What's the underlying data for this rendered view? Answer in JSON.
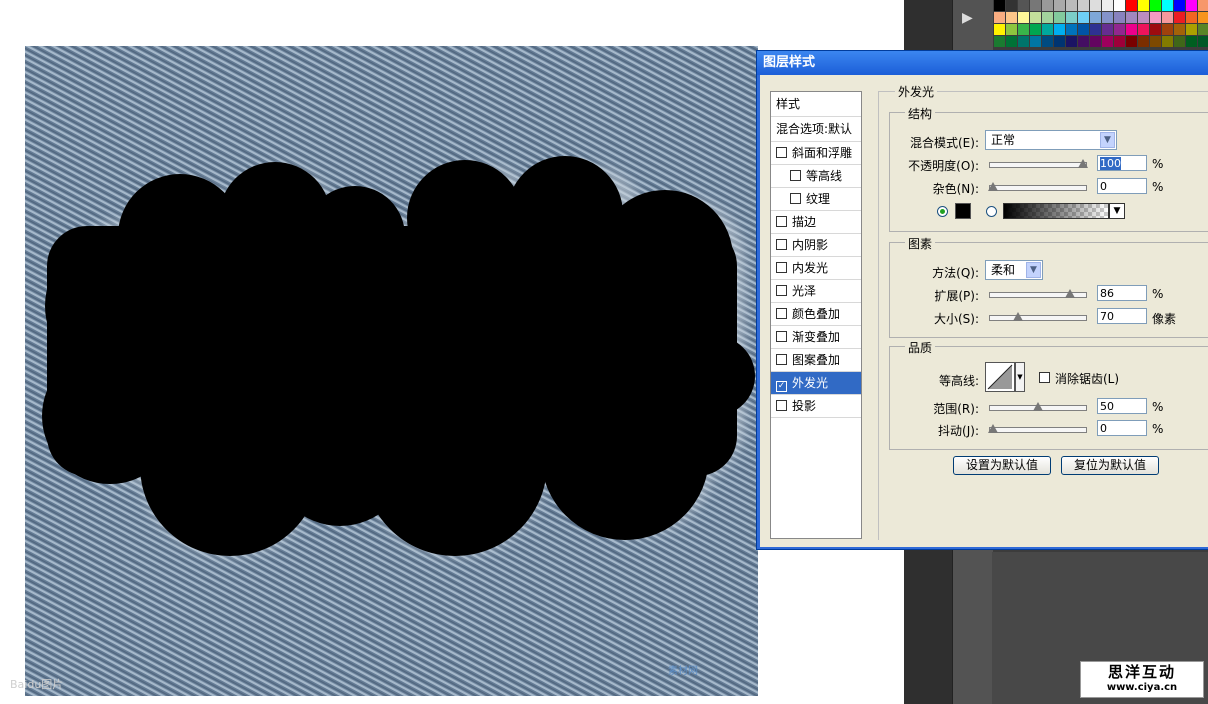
{
  "dialog": {
    "title": "图层样式",
    "style_list": {
      "header": "样式",
      "blend_default": "混合选项:默认",
      "items": [
        {
          "label": "斜面和浮雕",
          "checked": false,
          "indent": false
        },
        {
          "label": "等高线",
          "checked": false,
          "indent": true
        },
        {
          "label": "纹理",
          "checked": false,
          "indent": true
        },
        {
          "label": "描边",
          "checked": false,
          "indent": false
        },
        {
          "label": "内阴影",
          "checked": false,
          "indent": false
        },
        {
          "label": "内发光",
          "checked": false,
          "indent": false
        },
        {
          "label": "光泽",
          "checked": false,
          "indent": false
        },
        {
          "label": "颜色叠加",
          "checked": false,
          "indent": false
        },
        {
          "label": "渐变叠加",
          "checked": false,
          "indent": false
        },
        {
          "label": "图案叠加",
          "checked": false,
          "indent": false
        },
        {
          "label": "外发光",
          "checked": true,
          "indent": false,
          "selected": true
        },
        {
          "label": "投影",
          "checked": false,
          "indent": false
        }
      ]
    },
    "outer_glow": {
      "title": "外发光",
      "structure": {
        "title": "结构",
        "blend_mode_label": "混合模式(E):",
        "blend_mode_value": "正常",
        "opacity_label": "不透明度(O):",
        "opacity_value": "100",
        "noise_label": "杂色(N):",
        "noise_value": "0",
        "percent": "%",
        "opacity_level": 100,
        "noise_level": 0,
        "glow_color": "#000000"
      },
      "elements": {
        "title": "图素",
        "technique_label": "方法(Q):",
        "technique_value": "柔和",
        "spread_label": "扩展(P):",
        "spread_value": "86",
        "size_label": "大小(S):",
        "size_value": "70",
        "size_unit": "像素",
        "percent": "%",
        "spread_level": 86,
        "size_level": 28
      },
      "quality": {
        "title": "品质",
        "contour_label": "等高线:",
        "antialias_label": "消除锯齿(L)",
        "range_label": "范围(R):",
        "range_value": "50",
        "jitter_label": "抖动(J):",
        "jitter_value": "0",
        "percent": "%",
        "range_level": 50,
        "jitter_level": 0
      },
      "make_default": "设置为默认值",
      "reset_default": "复位为默认值"
    }
  },
  "logo": {
    "name": "思洋互动",
    "url": "www.ciya.cn"
  },
  "colors": {
    "denim": "#5f7892",
    "titlebar": "#2f6ad8",
    "selection": "#316ac5",
    "panel_dark": "#3c3c3c"
  }
}
